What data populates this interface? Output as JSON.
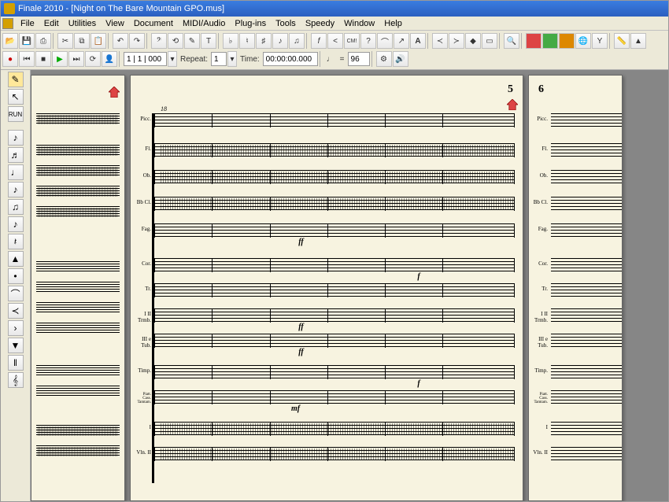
{
  "app": {
    "name": "Finale 2010",
    "document": "Night on The Bare Mountain GPO.mus",
    "title_full": "Finale 2010 - [Night on The Bare Mountain GPO.mus]"
  },
  "menubar": {
    "items": [
      "File",
      "Edit",
      "Utilities",
      "View",
      "Document",
      "MIDI/Audio",
      "Plug-ins",
      "Tools",
      "Speedy",
      "Window",
      "Help"
    ]
  },
  "toolbar_main": {
    "buttons": [
      "open",
      "save",
      "print",
      "cut",
      "copy",
      "paste",
      "undo",
      "redo",
      "lyrics",
      "repeat",
      "annotate",
      "text",
      "flat",
      "natural",
      "sharp",
      "eighth",
      "sixteenth",
      "note",
      "dynamics",
      "cresc",
      "forte",
      "mezzo",
      "piano",
      "cmi",
      "help",
      "tie",
      "slur",
      "articulation",
      "accent",
      "crescendo",
      "hairpin",
      "marker",
      "select",
      "zoom",
      "print2",
      "color1",
      "color2",
      "color3",
      "color4",
      "tuning",
      "ruler",
      "metronome"
    ]
  },
  "toolbar_playback": {
    "repeat_label": "Repeat:",
    "repeat_value": "1",
    "time_label": "Time:",
    "time_value": "00:00:00.000",
    "tempo_value": "96",
    "counter": "1 | 1 | 000",
    "buttons": [
      "rec",
      "rewind",
      "stop",
      "play",
      "ff",
      "loop",
      "human"
    ]
  },
  "palette": {
    "items": [
      "select",
      "eighth",
      "sixteenth",
      "rest",
      "rest2",
      "hand",
      "quarter",
      "half",
      "whole",
      "triplet",
      "tie",
      "cresc",
      "decresc",
      "barline",
      "accent",
      "staccato",
      "fermata",
      "text",
      "pedal"
    ]
  },
  "score": {
    "pages": [
      {
        "number": "",
        "visible_number": ""
      },
      {
        "number": "5",
        "measure_number": "18"
      },
      {
        "number": "6"
      }
    ],
    "instruments": [
      "Picc.",
      "Fl.",
      "Ob.",
      "Bb Cl.",
      "Fag.",
      "Cor.",
      "Tr.",
      "I II Trmb.",
      "III e Tub.",
      "Timp.",
      "Piatt. Cass. Tamtam.",
      "I",
      "Vln. II"
    ],
    "dynamics": [
      "ff",
      "ff",
      "ff",
      "mf",
      "f",
      "f"
    ]
  },
  "colors": {
    "titlebar": "#2b5fc0",
    "chrome": "#ece9d8",
    "paper": "#f7f3e0",
    "canvas_bg": "#868686"
  }
}
